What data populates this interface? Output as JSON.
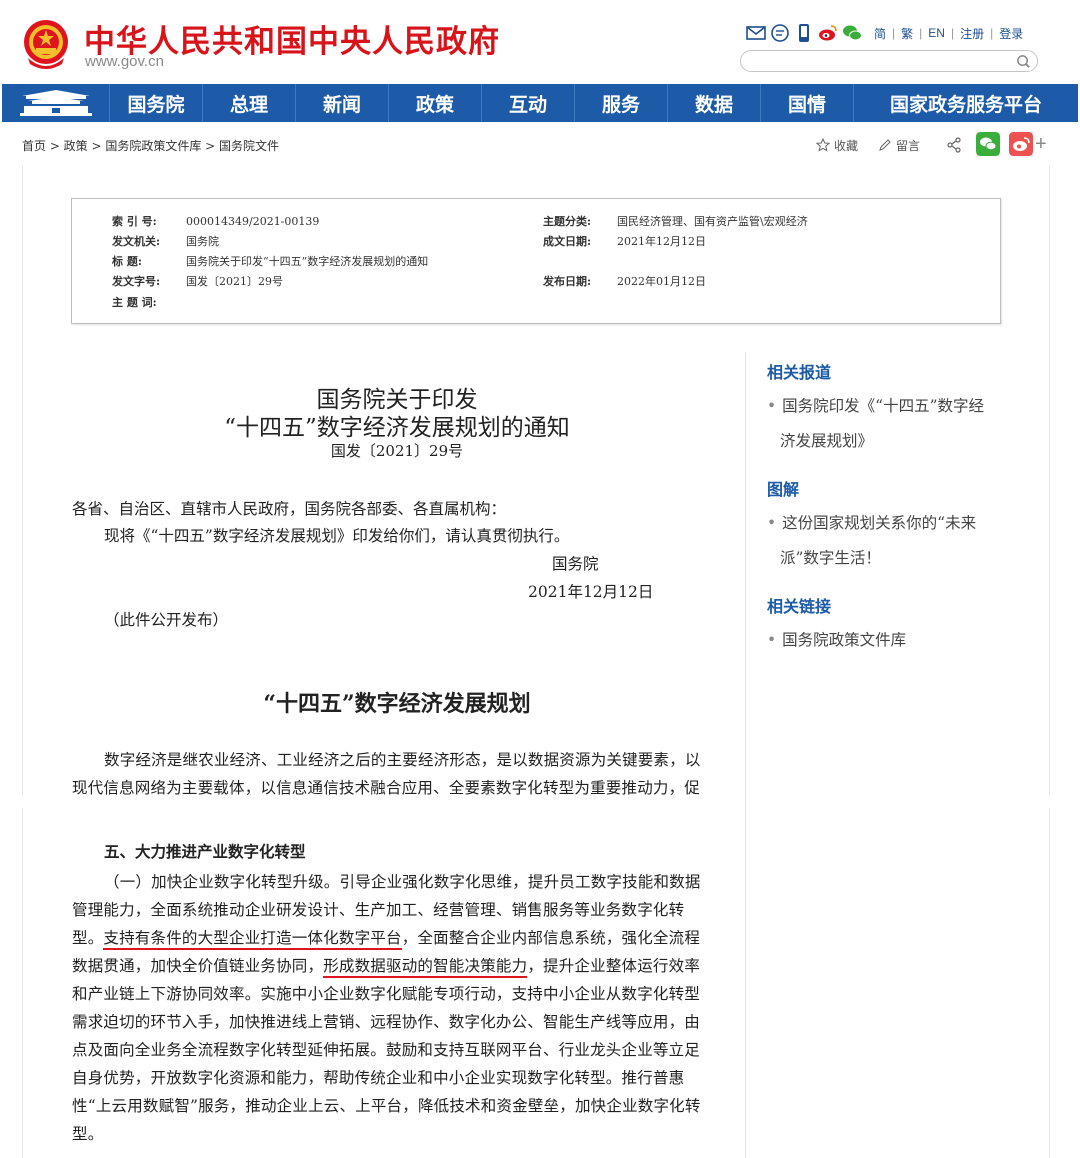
{
  "header": {
    "site_title": "中华人民共和国中央人民政府",
    "site_url": "www.gov.cn",
    "toolbar": {
      "simplified": "简",
      "traditional": "繁",
      "english": "EN",
      "register": "注册",
      "login": "登录"
    },
    "search": {
      "value": "",
      "placeholder": ""
    }
  },
  "nav": {
    "items": [
      "国务院",
      "总理",
      "新闻",
      "政策",
      "互动",
      "服务",
      "数据",
      "国情"
    ],
    "platform": "国家政务服务平台"
  },
  "breadcrumb": {
    "text": "首页 > 政策 > 国务院政策文件库 > 国务院文件"
  },
  "actions": {
    "favorite": "收藏",
    "comment": "留言"
  },
  "meta": {
    "index_no_label": "索 引 号:",
    "index_no": "000014349/2021-00139",
    "issuer_label": "发文机关:",
    "issuer": "国务院",
    "title_label": "标      题:",
    "title": "国务院关于印发“十四五”数字经济发展规划的通知",
    "doc_no_label": "发文字号:",
    "doc_no": "国发〔2021〕29号",
    "keywords_label": "主 题 词:",
    "keywords": "",
    "category_label": "主题分类:",
    "category": "国民经济管理、国有资产监管\\宏观经济",
    "created_label": "成文日期:",
    "created": "2021年12月12日",
    "published_label": "发布日期:",
    "published": "2022年01月12日"
  },
  "document": {
    "title_line1": "国务院关于印发",
    "title_line2": "“十四五”数字经济发展规划的通知",
    "doc_no": "国发〔2021〕29号",
    "addressee": "各省、自治区、直辖市人民政府，国务院各部委、各直属机构：",
    "notice": "现将《“十四五”数字经济发展规划》印发给你们，请认真贯彻执行。",
    "signer": "国务院",
    "date": "2021年12月12日",
    "release_note": "（此件公开发布）",
    "plan_title": "“十四五”数字经济发展规划",
    "intro_line1": "数字经济是继农业经济、工业经济之后的主要经济形态，是以数据资源为关键要素，以",
    "intro_line2": "现代信息网络为主要载体，以信息通信技术融合应用、全要素数字化转型为重要推动力，促",
    "section_heading": "五、大力推进产业数字化转型",
    "lines": {
      "l1": "（一）加快企业数字化转型升级。引导企业强化数字化思维，提升员工数字技能和数据",
      "l2": "管理能力，全面系统推动企业研发设计、生产加工、经营管理、销售服务等业务数字化转",
      "l3a": "型。",
      "l3u": "支持有条件的大型企业打造一体化数字平台",
      "l3b": "，全面整合企业内部信息系统，强化全流程",
      "l4a": "数据贯通，加快全价值链业务协同，",
      "l4u": "形成数据驱动的智能决策能力",
      "l4b": "，提升企业整体运行效率",
      "l5": "和产业链上下游协同效率。实施中小企业数字化赋能专项行动，支持中小企业从数字化转型",
      "l6": "需求迫切的环节入手，加快推进线上营销、远程协作、数字化办公、智能生产线等应用，由",
      "l7": "点及面向全业务全流程数字化转型延伸拓展。鼓励和支持互联网平台、行业龙头企业等立足",
      "l8": "自身优势，开放数字化资源和能力，帮助传统企业和中小企业实现数字化转型。推行普惠",
      "l9": "性“上云用数赋智”服务，推动企业上云、上平台，降低技术和资金壁垒，加快企业数字化转",
      "l10": "型。"
    }
  },
  "sidebar": {
    "related_title": "相关报道",
    "related_line1": "国务院印发《“十四五”数字经",
    "related_line2": "济发展规划》",
    "graphic_title": "图解",
    "graphic_line1": "这份国家规划关系你的“未来",
    "graphic_line2": "派”数字生活！",
    "links_title": "相关链接",
    "links_item": "国务院政策文件库"
  },
  "colors": {
    "brand_red": "#d7141a",
    "nav_blue": "#1d5ba8",
    "underline_red": "#e0141e"
  }
}
